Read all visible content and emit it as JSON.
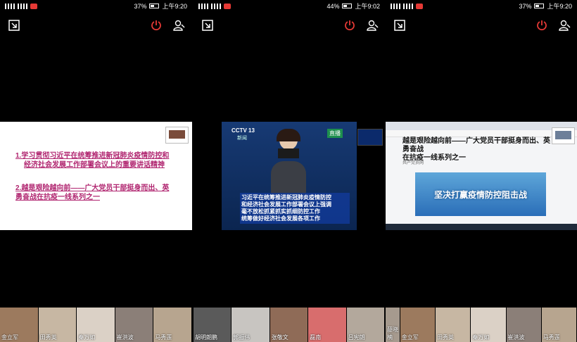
{
  "panels": [
    {
      "status": {
        "battery": "37%",
        "time": "上午9:20"
      },
      "slide": {
        "line1a": "1.学习贯彻习近平在统筹推进新冠肺炎疫情防控和",
        "line1b": "经济社会发展工作部署会议上的重要讲话精神",
        "line2a": "2.越是艰险越向前——广大党员干部挺身而出、英",
        "line2b": "勇奋战在抗疫一线系列之一"
      },
      "participants": [
        {
          "name": "金立军"
        },
        {
          "name": "田秀英"
        },
        {
          "name": "秦万如"
        },
        {
          "name": "崔洪波"
        },
        {
          "name": "马秀莲"
        }
      ]
    },
    {
      "status": {
        "battery": "44%",
        "time": "上午9:02"
      },
      "news": {
        "channel": "CCTV 13",
        "subchannel": "新闻",
        "live": "直播",
        "line1": "习近平在统筹推进新冠肺炎疫情防控",
        "line2": "和经济社会发展工作部署会议上强调",
        "line3": "毫不放松抓紧抓实抓细防控工作",
        "line4": "统筹做好经济社会发展各项工作"
      },
      "participants": [
        {
          "name": "胡明朗鹏"
        },
        {
          "name": "郭振伟"
        },
        {
          "name": "张敬文"
        },
        {
          "name": "磊南"
        },
        {
          "name": "吕宪朗"
        }
      ]
    },
    {
      "status": {
        "battery": "37%",
        "time": "上午9:20"
      },
      "web": {
        "headline1": "越是艰险越向前——广大党员干部挺身而出、英勇奋战",
        "headline2": "在抗疫一线系列之一",
        "banner": "坚决打赢疫情防控阻击战",
        "source": "共产党员网"
      },
      "participants": [
        {
          "name": "薛晓楠"
        },
        {
          "name": "金立军"
        },
        {
          "name": "田秀英"
        },
        {
          "name": "秦万如"
        },
        {
          "name": "崔洪波"
        },
        {
          "name": "马秀莲"
        }
      ]
    }
  ],
  "colors": {
    "slide_text": "#b0246f",
    "power_icon": "#e53935",
    "news_blue": "#0b2a6b"
  },
  "icons": [
    "exit-icon",
    "power-icon",
    "user-icon",
    "search-icon"
  ]
}
